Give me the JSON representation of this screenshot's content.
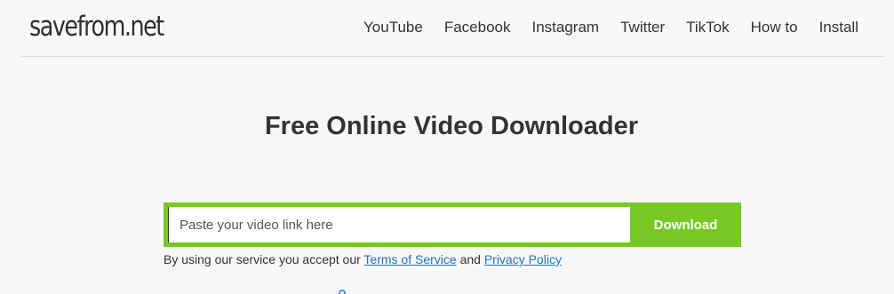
{
  "header": {
    "logo": "savefrom.net",
    "nav": [
      {
        "label": "YouTube"
      },
      {
        "label": "Facebook"
      },
      {
        "label": "Instagram"
      },
      {
        "label": "Twitter"
      },
      {
        "label": "TikTok"
      },
      {
        "label": "How to"
      },
      {
        "label": "Install"
      }
    ]
  },
  "main": {
    "title": "Free Online Video Downloader",
    "search": {
      "placeholder": "Paste your video link here",
      "value": "",
      "button_label": "Download"
    },
    "terms": {
      "prefix": "By using our service you accept our",
      "terms_link": "Terms of Service",
      "and": "and",
      "privacy_link": "Privacy Policy"
    }
  },
  "colors": {
    "accent": "#77c824",
    "link": "#1e73be",
    "background": "#f8f8f8"
  }
}
